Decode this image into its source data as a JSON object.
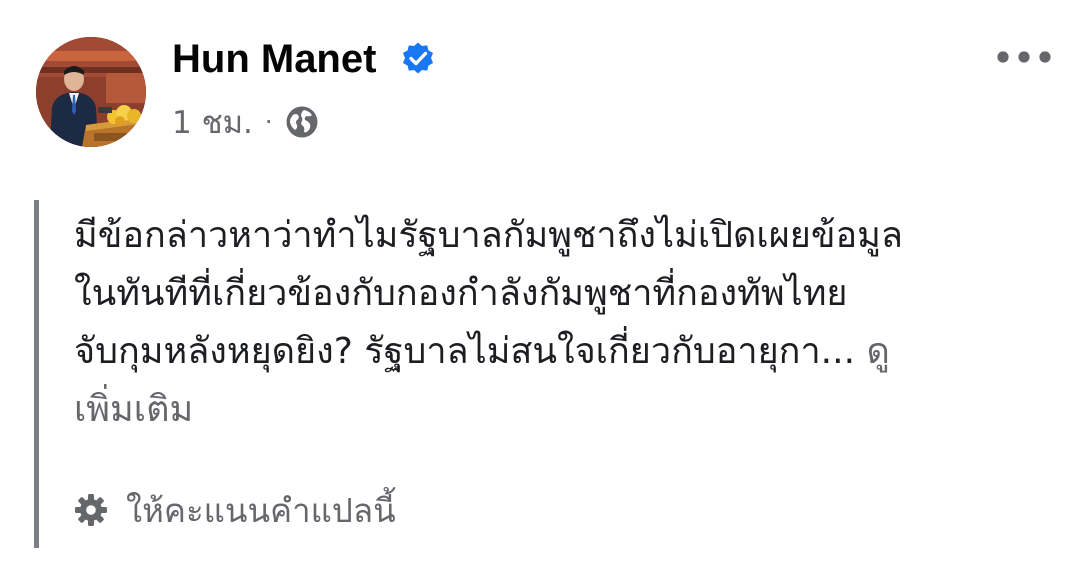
{
  "post": {
    "author": "Hun Manet",
    "verified": true,
    "time": "1 ชม.",
    "separator": "·",
    "audience_icon": "globe-icon",
    "more_icon": "more-horizontal-icon",
    "text_lines": [
      "มีข้อกล่าวหาว่าทำไมรัฐบาลกัมพูชาถึงไม่เปิดเผยข้อมูล",
      "ในทันทีที่เกี่ยวข้องกับกองกำลังกัมพูชาที่กองทัพไทย",
      "จับกุมหลังหยุดยิง? รัฐบาลไม่สนใจเกี่ยวกับอายุกา..."
    ],
    "see_more_part1": " ดู",
    "see_more_part2": "เพิ่มเติม",
    "translation": {
      "icon": "gear-icon",
      "label": "ให้คะแนนคำแปลนี้"
    }
  },
  "colors": {
    "verified_blue": "#1877f2",
    "secondary_text": "#65676b",
    "quote_bar": "#7c7f83"
  }
}
